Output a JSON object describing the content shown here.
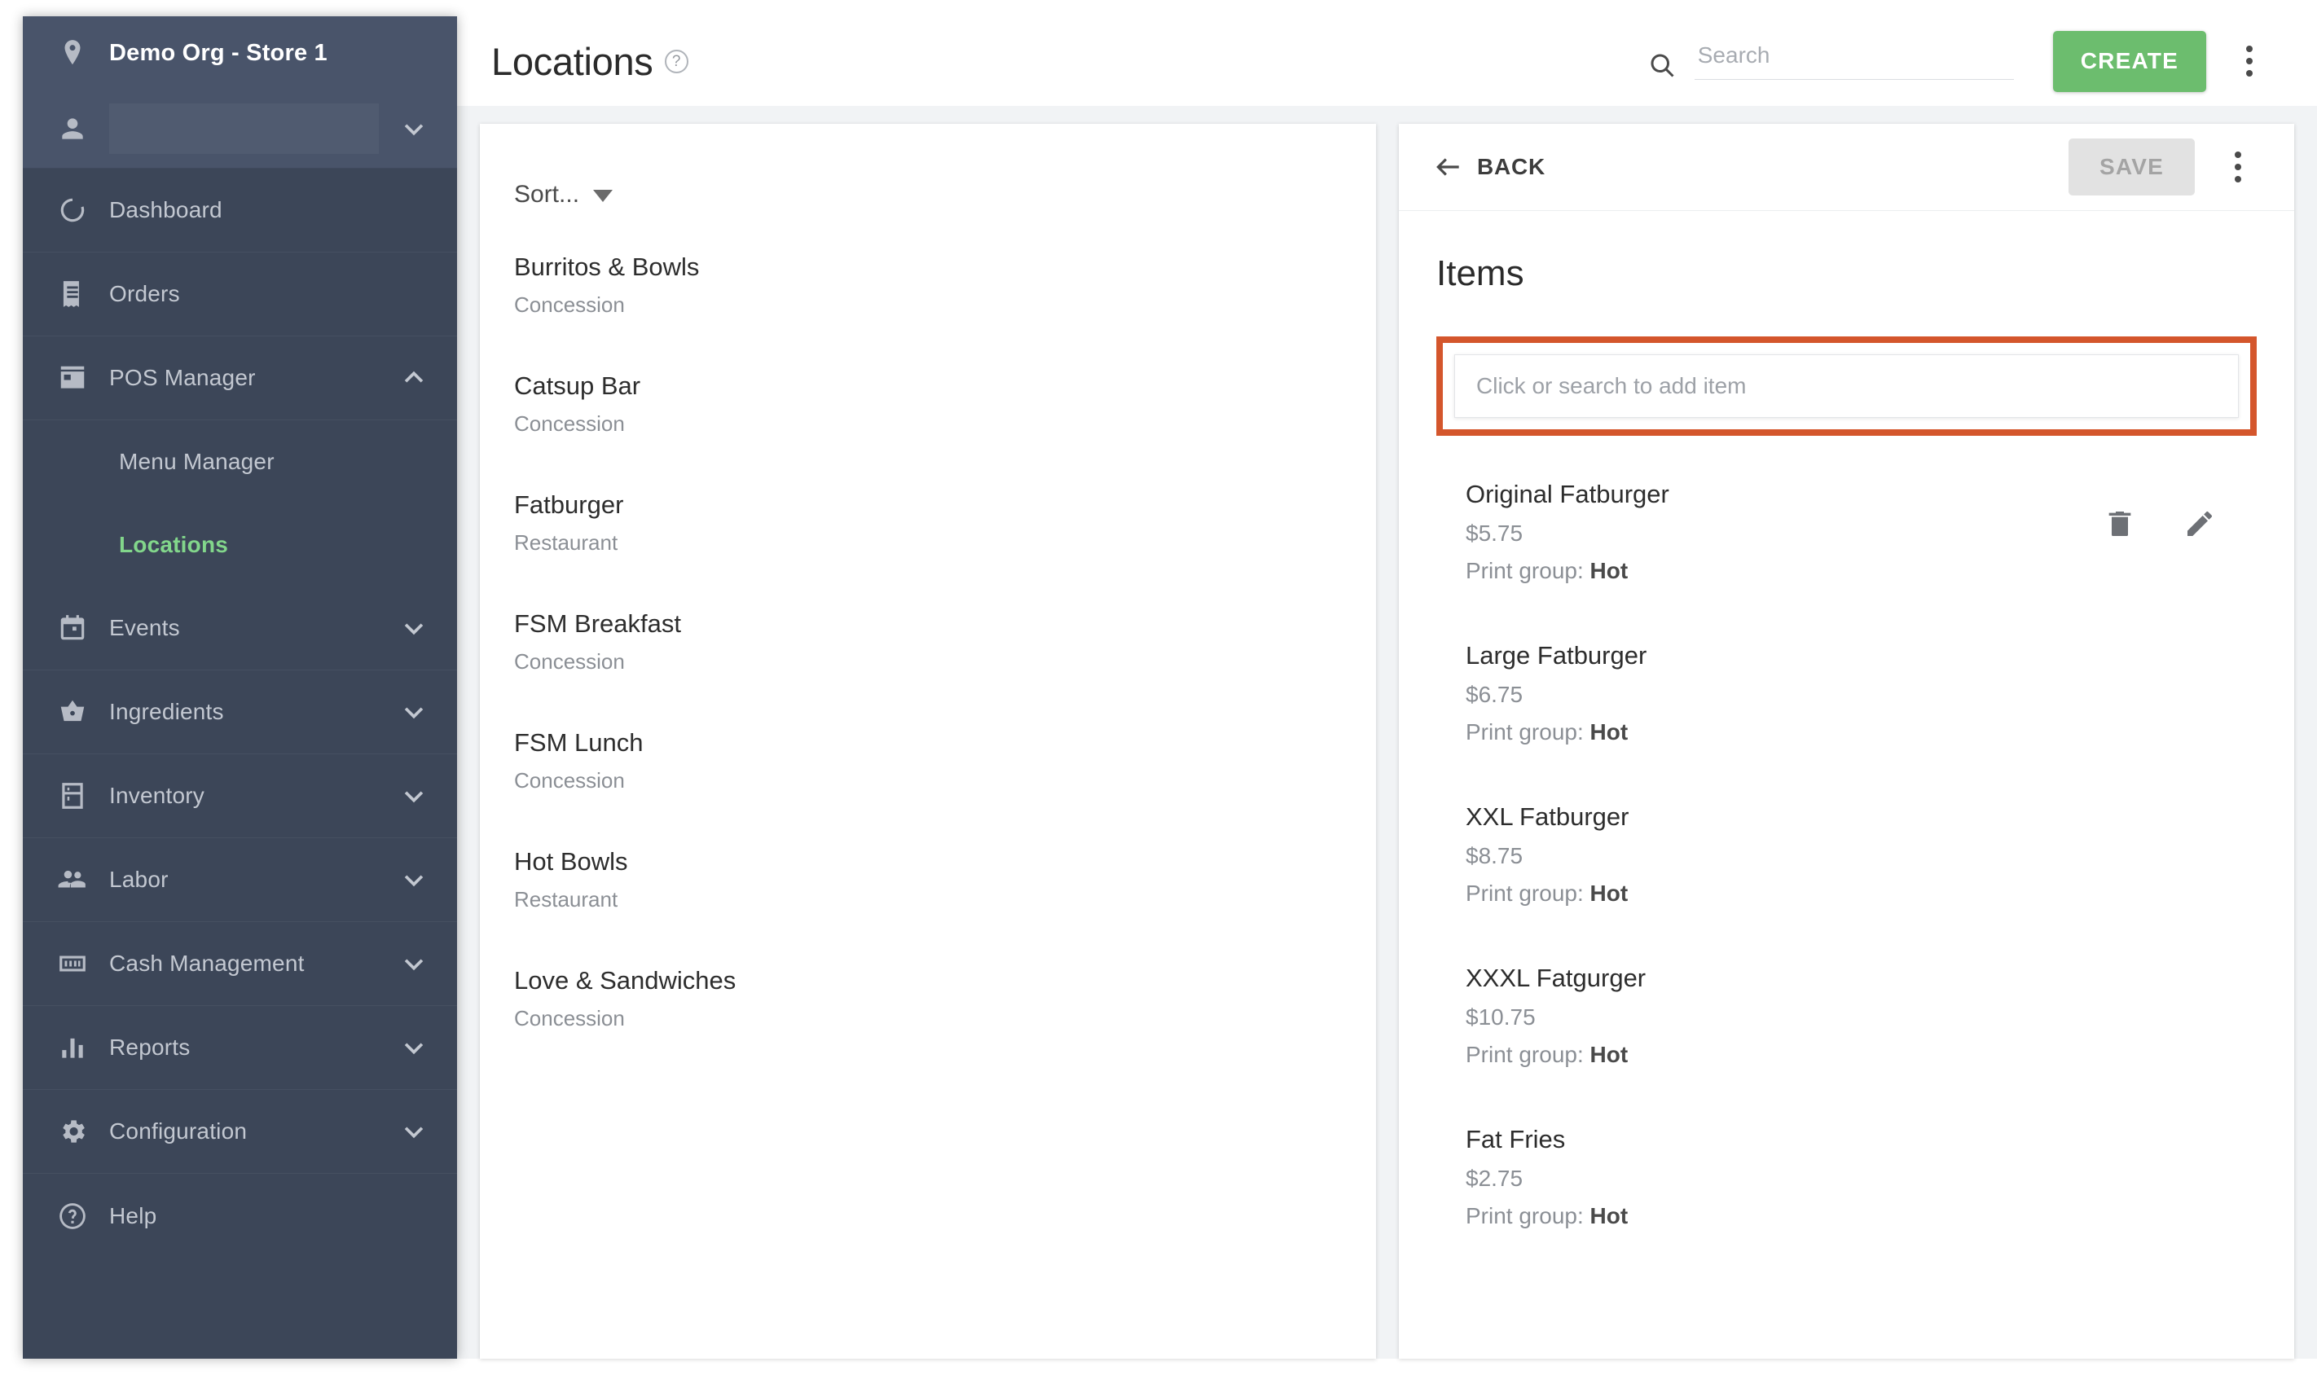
{
  "sidebar": {
    "org_name": "Demo Org - Store 1",
    "user_value": "",
    "items": [
      {
        "label": "Dashboard",
        "icon": "dashboard-icon",
        "expandable": false,
        "active": false
      },
      {
        "label": "Orders",
        "icon": "receipt-icon",
        "expandable": false,
        "active": false
      },
      {
        "label": "POS Manager",
        "icon": "store-icon",
        "expandable": true,
        "expanded": true,
        "active": false
      },
      {
        "label": "Menu Manager",
        "icon": "",
        "sub": true,
        "active": false
      },
      {
        "label": "Locations",
        "icon": "",
        "sub": true,
        "active": true
      },
      {
        "label": "Events",
        "icon": "calendar-icon",
        "expandable": true,
        "expanded": false,
        "active": false
      },
      {
        "label": "Ingredients",
        "icon": "basket-icon",
        "expandable": true,
        "expanded": false,
        "active": false
      },
      {
        "label": "Inventory",
        "icon": "fridge-icon",
        "expandable": true,
        "expanded": false,
        "active": false
      },
      {
        "label": "Labor",
        "icon": "people-icon",
        "expandable": true,
        "expanded": false,
        "active": false
      },
      {
        "label": "Cash Management",
        "icon": "cash-icon",
        "expandable": true,
        "expanded": false,
        "active": false
      },
      {
        "label": "Reports",
        "icon": "bar-chart-icon",
        "expandable": true,
        "expanded": false,
        "active": false
      },
      {
        "label": "Configuration",
        "icon": "gear-icon",
        "expandable": true,
        "expanded": false,
        "active": false
      },
      {
        "label": "Help",
        "icon": "help-circle-icon",
        "expandable": false,
        "active": false
      }
    ]
  },
  "topbar": {
    "title": "Locations",
    "help_icon": "?",
    "search_placeholder": "Search",
    "search_value": "",
    "create_label": "CREATE",
    "menu_icon": "more-vertical-icon"
  },
  "list_panel": {
    "sort_label": "Sort...",
    "locations": [
      {
        "name": "Burritos & Bowls",
        "type": "Concession"
      },
      {
        "name": "Catsup Bar",
        "type": "Concession"
      },
      {
        "name": "Fatburger",
        "type": "Restaurant"
      },
      {
        "name": "FSM Breakfast",
        "type": "Concession"
      },
      {
        "name": "FSM Lunch",
        "type": "Concession"
      },
      {
        "name": "Hot Bowls",
        "type": "Restaurant"
      },
      {
        "name": "Love & Sandwiches",
        "type": "Concession"
      }
    ]
  },
  "detail_panel": {
    "back_label": "BACK",
    "save_label": "SAVE",
    "save_disabled": true,
    "menu_icon": "more-vertical-icon",
    "section_title": "Items",
    "add_item_placeholder": "Click or search to add item",
    "add_item_value": "",
    "print_group_prefix": "Print group: ",
    "items": [
      {
        "name": "Original Fatburger",
        "price": "$5.75",
        "print_group": "Hot",
        "has_actions": true
      },
      {
        "name": "Large Fatburger",
        "price": "$6.75",
        "print_group": "Hot",
        "has_actions": false
      },
      {
        "name": "XXL Fatburger",
        "price": "$8.75",
        "print_group": "Hot",
        "has_actions": false
      },
      {
        "name": "XXXL Fatgurger",
        "price": "$10.75",
        "print_group": "Hot",
        "has_actions": false
      },
      {
        "name": "Fat Fries",
        "price": "$2.75",
        "print_group": "Hot",
        "has_actions": false
      }
    ],
    "row_action_icons": [
      "trash-icon",
      "pencil-icon"
    ]
  },
  "colors": {
    "sidebar_bg": "#3c4658",
    "sidebar_top_bg": "#49546a",
    "accent_green": "#6cbd6e",
    "active_green": "#82d68b",
    "highlight_orange": "#d4562c",
    "page_bg": "#f1f3f5"
  }
}
